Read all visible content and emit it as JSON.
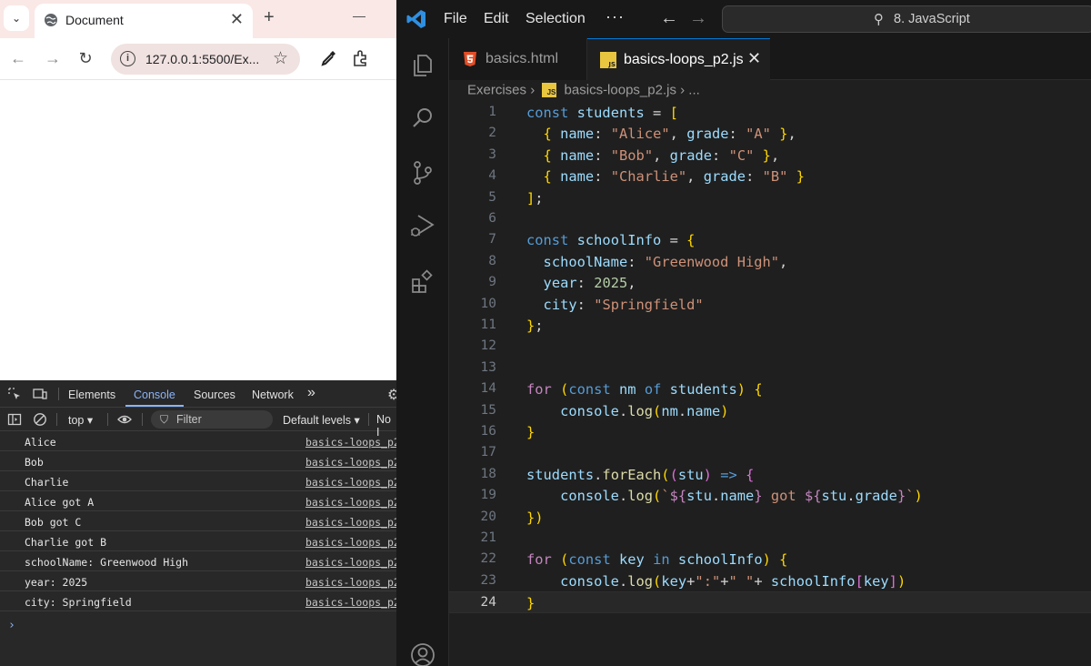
{
  "browser": {
    "tab_title": "Document",
    "tab_close": "✕",
    "new_tab": "+",
    "url": "127.0.0.1:5500/Ex...",
    "devtools": {
      "tabs": [
        "Elements",
        "Console",
        "Sources",
        "Network"
      ],
      "more": "»",
      "context": "top",
      "filter_placeholder": "Filter",
      "levels": "Default levels",
      "no_issues": "No I",
      "logs": [
        {
          "msg": "Alice",
          "src": "basics-loops_p2"
        },
        {
          "msg": "Bob",
          "src": "basics-loops_p2"
        },
        {
          "msg": "Charlie",
          "src": "basics-loops_p2"
        },
        {
          "msg": "Alice got A",
          "src": "basics-loops_p2"
        },
        {
          "msg": "Bob got C",
          "src": "basics-loops_p2"
        },
        {
          "msg": "Charlie got B",
          "src": "basics-loops_p2"
        },
        {
          "msg": "schoolName: Greenwood High",
          "src": "basics-loops_p2"
        },
        {
          "msg": "year: 2025",
          "src": "basics-loops_p2"
        },
        {
          "msg": "city: Springfield",
          "src": "basics-loops_p2"
        }
      ],
      "prompt": "›"
    }
  },
  "vscode": {
    "menu": [
      "File",
      "Edit",
      "Selection"
    ],
    "more_menu": "···",
    "search_text": "8. JavaScript",
    "tabs": [
      {
        "label": "basics.html",
        "active": false
      },
      {
        "label": "basics-loops_p2.js",
        "active": true
      }
    ],
    "tab_close": "✕",
    "breadcrumb": {
      "folder": "Exercises",
      "file": "basics-loops_p2.js",
      "more": "..."
    },
    "current_line": 24,
    "code_lines": [
      "const students = [",
      "  { name: \"Alice\", grade: \"A\" },",
      "  { name: \"Bob\", grade: \"C\" },",
      "  { name: \"Charlie\", grade: \"B\" }",
      "];",
      "",
      "const schoolInfo = {",
      "  schoolName: \"Greenwood High\",",
      "  year: 2025,",
      "  city: \"Springfield\"",
      "};",
      "",
      "",
      "for (const nm of students) {",
      "    console.log(nm.name)",
      "}",
      "",
      "students.forEach((stu) => {",
      "    console.log(`${stu.name} got ${stu.grade}`)",
      "})",
      "",
      "for (const key in schoolInfo) {",
      "    console.log(key+\":\"+\" \"+ schoolInfo[key])",
      "}"
    ]
  },
  "colors": {
    "keyword": "#569cd6",
    "control": "#c586c0",
    "variable": "#9cdcfe",
    "string": "#ce9178",
    "number": "#b5cea8",
    "function": "#dcdcaa",
    "accent": "#0078d4"
  },
  "icons": {
    "browser": [
      "chevron-down-icon",
      "globe-icon",
      "close-icon",
      "plus-icon",
      "back-arrow-icon",
      "forward-arrow-icon",
      "reload-icon",
      "info-icon",
      "star-icon",
      "eyedropper-icon",
      "extensions-icon"
    ],
    "devtools": [
      "inspect-icon",
      "device-icon",
      "sidebar-icon",
      "clear-icon",
      "eye-icon",
      "filter-icon",
      "gear-icon"
    ],
    "vscode": [
      "vscode-logo-icon",
      "explorer-icon",
      "search-icon",
      "source-control-icon",
      "run-debug-icon",
      "extensions-icon",
      "account-icon",
      "html-icon",
      "js-icon"
    ]
  }
}
